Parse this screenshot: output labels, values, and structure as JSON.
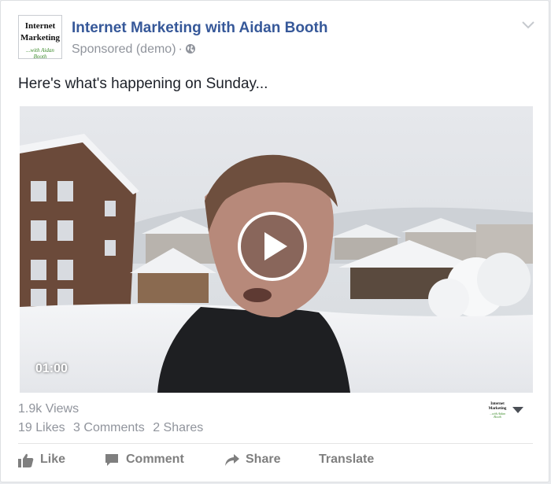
{
  "post": {
    "page_name": "Internet Marketing with Aidan Booth",
    "sponsored_label": "Sponsored (demo)",
    "separator": "·",
    "audience_icon": "globe-icon",
    "menu_icon": "chevron-down-icon",
    "text": "Here's what's happening on Sunday..."
  },
  "avatar": {
    "line1": "Internet",
    "line2": "Marketing",
    "line3": "...with Aidan Booth"
  },
  "video": {
    "duration": "01:00",
    "play_icon": "play-icon"
  },
  "stats": {
    "views": "1.9k Views",
    "likes": "19 Likes",
    "comments": "3 Comments",
    "shares": "2 Shares"
  },
  "mini_logo": {
    "line1": "Internet",
    "line2": "Marketing",
    "line3": "...with Aidan Booth"
  },
  "actions": {
    "like": "Like",
    "comment": "Comment",
    "share": "Share",
    "translate": "Translate"
  },
  "colors": {
    "link": "#365899",
    "meta": "#90949c",
    "action": "#7f7f7f"
  }
}
